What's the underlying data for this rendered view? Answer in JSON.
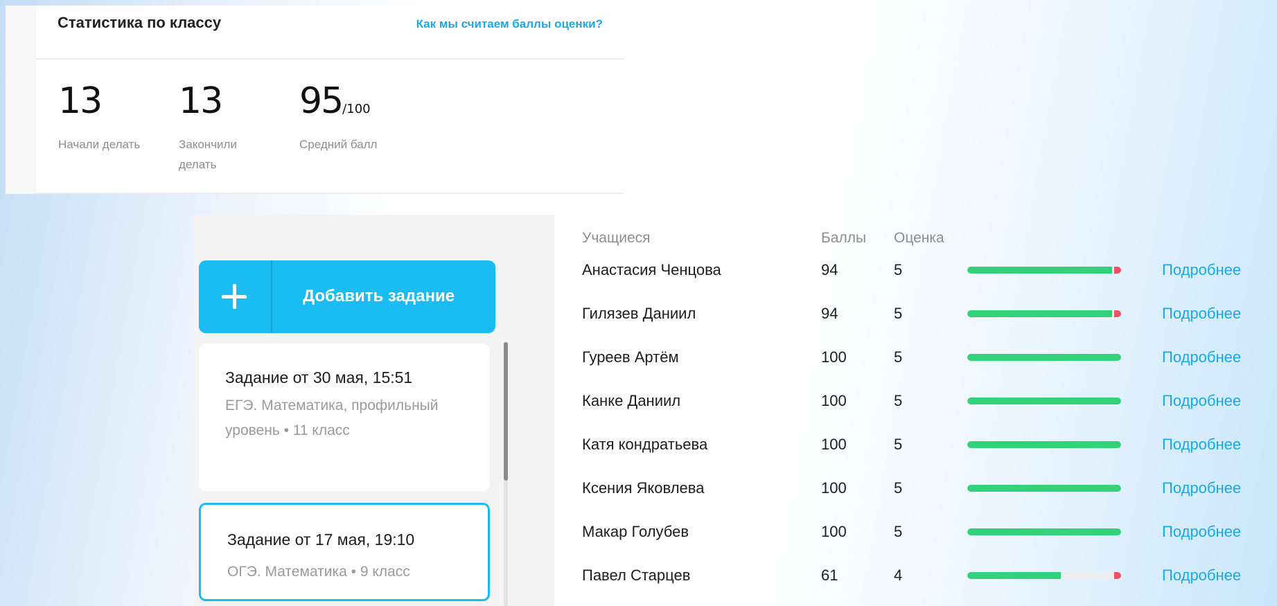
{
  "stats": {
    "title": "Статистика по классу",
    "help_link": "Как мы считаем баллы оценки?",
    "items": [
      {
        "value": "13",
        "suffix": "",
        "label": "Начали делать"
      },
      {
        "value": "13",
        "suffix": "",
        "label": "Закончили делать"
      },
      {
        "value": "95",
        "suffix": "/100",
        "label": "Средний балл"
      }
    ]
  },
  "sidebar": {
    "add_button_label": "Добавить задание",
    "tasks": [
      {
        "title": "Задание от 30 мая, 15:51",
        "subtitle": "ЕГЭ. Математика, профильный уровень • 11 класс",
        "selected": false
      },
      {
        "title": "Задание от 17 мая, 19:10",
        "subtitle": "ОГЭ. Математика • 9 класс",
        "selected": true
      }
    ]
  },
  "results": {
    "headers": {
      "students": "Учащиеся",
      "points": "Баллы",
      "grade": "Оценка"
    },
    "more_label": "Подробнее",
    "rows": [
      {
        "name": "Анастасия Ченцова",
        "points": "94",
        "grade": "5",
        "progress": 94
      },
      {
        "name": "Гилязев Даниил",
        "points": "94",
        "grade": "5",
        "progress": 94
      },
      {
        "name": "Гуреев Артём",
        "points": "100",
        "grade": "5",
        "progress": 100
      },
      {
        "name": "Канке Даниил",
        "points": "100",
        "grade": "5",
        "progress": 100
      },
      {
        "name": "Катя кондратьева",
        "points": "100",
        "grade": "5",
        "progress": 100
      },
      {
        "name": "Ксения Яковлева",
        "points": "100",
        "grade": "5",
        "progress": 100
      },
      {
        "name": "Макар Голубев",
        "points": "100",
        "grade": "5",
        "progress": 100
      },
      {
        "name": "Павел Старцев",
        "points": "61",
        "grade": "4",
        "progress": 61
      }
    ]
  },
  "colors": {
    "accent": "#1bbcf2",
    "link": "#1aa7e8",
    "progress_ok": "#33d17a",
    "progress_error": "#ee5165"
  }
}
